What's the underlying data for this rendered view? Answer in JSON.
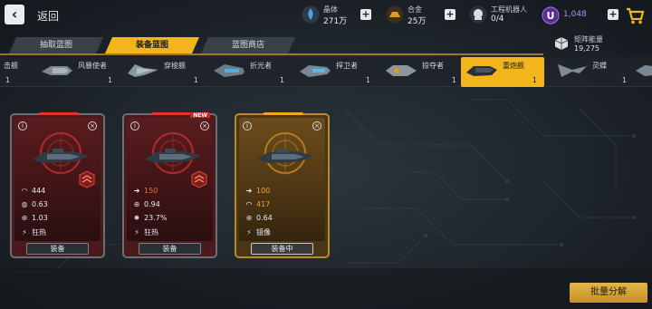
{
  "header": {
    "back_label": "返回",
    "resources": [
      {
        "name": "晶体",
        "value": "271万",
        "icon": "crystal-icon",
        "color": "#3b8ee8"
      },
      {
        "name": "合金",
        "value": "25万",
        "icon": "alloy-icon",
        "color": "#e09a1c"
      },
      {
        "name": "工程机器人",
        "value": "0/4",
        "icon": "robot-icon",
        "color": "#d8dde2"
      }
    ],
    "premium": {
      "value": "1,048",
      "icon": "u-coin-icon",
      "color": "#8a4fd0"
    },
    "cart_icon": "shopping-cart-icon"
  },
  "tabs": [
    {
      "label": "抽取蓝图",
      "active": false
    },
    {
      "label": "装备蓝图",
      "active": true
    },
    {
      "label": "蓝图商店",
      "active": false
    }
  ],
  "matrix_energy": {
    "name": "矩阵能量",
    "value": "19,275",
    "icon": "cube-icon"
  },
  "ships": [
    {
      "name": "击舰",
      "count": "1",
      "active": false
    },
    {
      "name": "风暴使者",
      "count": "1",
      "active": false
    },
    {
      "name": "穿梭舰",
      "count": "1",
      "active": false
    },
    {
      "name": "折光者",
      "count": "1",
      "active": false
    },
    {
      "name": "捍卫者",
      "count": "1",
      "active": false
    },
    {
      "name": "掠夺者",
      "count": "1",
      "active": false
    },
    {
      "name": "重炮舰",
      "count": "1",
      "active": true
    },
    {
      "name": "灵蝶",
      "count": "1",
      "active": false
    }
  ],
  "cards": [
    {
      "rarity": "red",
      "new": false,
      "stats": [
        {
          "icon": "armor-icon",
          "value": "444",
          "highlight": false
        },
        {
          "icon": "shield-icon",
          "value": "0.63",
          "highlight": false
        },
        {
          "icon": "crosshair-icon",
          "value": "1.03",
          "highlight": false
        },
        {
          "icon": "ability-icon",
          "value": "狂热",
          "highlight": false
        }
      ],
      "button": "装备"
    },
    {
      "rarity": "red",
      "new": true,
      "new_label": "NEW",
      "stats": [
        {
          "icon": "speed-arrow-icon",
          "value": "150",
          "highlight": true
        },
        {
          "icon": "crosshair-icon",
          "value": "0.94",
          "highlight": false
        },
        {
          "icon": "crit-icon",
          "value": "23.7%",
          "highlight": false
        },
        {
          "icon": "ability-icon",
          "value": "狂热",
          "highlight": false
        }
      ],
      "button": "装备"
    },
    {
      "rarity": "gold",
      "new": false,
      "stats": [
        {
          "icon": "speed-arrow-icon",
          "value": "100",
          "highlight": "gold"
        },
        {
          "icon": "armor-icon",
          "value": "417",
          "highlight": "gold"
        },
        {
          "icon": "crosshair-icon",
          "value": "0.64",
          "highlight": false
        },
        {
          "icon": "ability-icon",
          "value": "镜像",
          "highlight": false
        }
      ],
      "button": "装备中"
    }
  ],
  "bulk_decompose_label": "批量分解",
  "colors": {
    "accent": "#f2b51c",
    "red_card": "#4a1a1c",
    "gold_card": "#4a3515",
    "highlight_red": "#ff6a3a",
    "highlight_gold": "#f3a52c"
  }
}
